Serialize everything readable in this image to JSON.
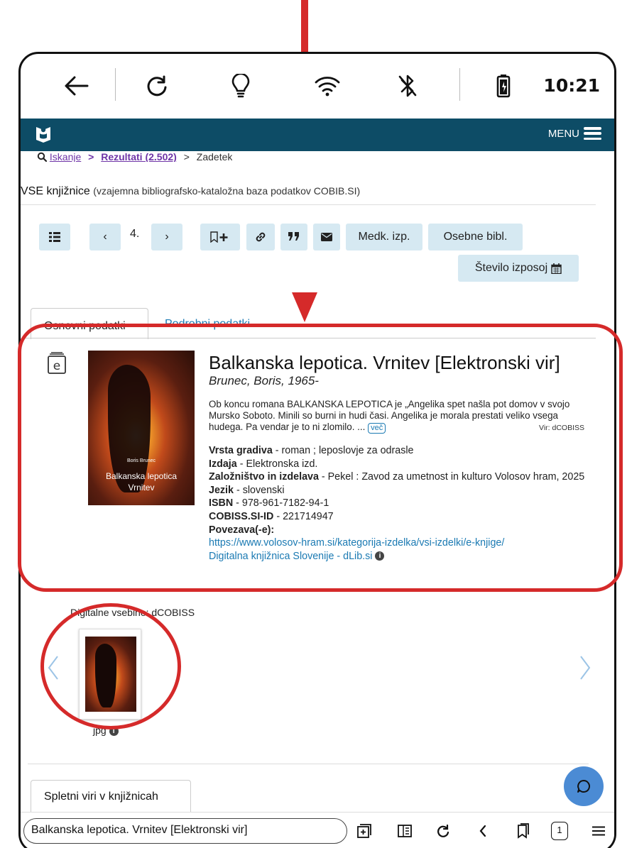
{
  "status_bar": {
    "time": "10:21",
    "icons": [
      "back-arrow-icon",
      "refresh-icon",
      "lightbulb-icon",
      "wifi-icon",
      "bluetooth-off-icon",
      "battery-icon"
    ]
  },
  "app_bar": {
    "menu_label": "MENU"
  },
  "breadcrumb": {
    "search": "Iskanje",
    "sep1": ">",
    "results": "Rezultati (2.502)",
    "sep2": ">",
    "current": "Zadetek"
  },
  "heading": {
    "title": "VSE knjižnice",
    "subtitle": "(vzajemna bibliografsko-kataložna baza podatkov COBIB.SI)"
  },
  "toolbar": {
    "page_number": "4.",
    "prev": "‹",
    "next": "›",
    "medk_izp": "Medk. izp.",
    "osebne_bibl": "Osebne bibl.",
    "stevilo_izposoj": "Število izposoj"
  },
  "tabs": {
    "basic": "Osnovni podatki",
    "detailed": "Podrobni podatki"
  },
  "record": {
    "title": "Balkanska lepotica. Vrnitev [Elektronski vir]",
    "author": "Brunec, Boris, 1965-",
    "description": "Ob koncu romana BALKANSKA LEPOTICA je „Angelika spet našla pot domov v svojo Mursko Soboto. Minili so burni in hudi časi. Angelika je morala prestati veliko vsega hudega. Pa vendar je to ni zlomilo. ...",
    "more": "več",
    "source": "Vir: dCOBISS",
    "cover": {
      "author": "Boris Brunec",
      "title_line1": "Balkanska lepotica",
      "title_line2": "Vrnitev"
    },
    "fields": {
      "vrsta_label": "Vrsta gradiva",
      "vrsta_value": "- roman ; leposlovje za odrasle",
      "izdaja_label": "Izdaja",
      "izdaja_value": "- Elektronska izd.",
      "zalozba_label": "Založništvo in izdelava",
      "zalozba_value": "- Pekel : Zavod za umetnost in kulturo Volosov hram, 2025",
      "jezik_label": "Jezik",
      "jezik_value": "- slovenski",
      "isbn_label": "ISBN",
      "isbn_value": "- 978-961-7182-94-1",
      "cobiss_label": "COBISS.SI-ID",
      "cobiss_value": "- 221714947",
      "povezave_label": "Povezava(-e):",
      "link1": "https://www.volosov-hram.si/kategorija-izdelka/vsi-izdelki/e-knjige/",
      "link2": "Digitalna knjižnica Slovenije - dLib.si"
    }
  },
  "digital": {
    "label": "Digitalne vsebine: dCOBISS",
    "file_type": "jpg"
  },
  "spletni_viri": "Spletni viri v knjižnicah",
  "bottom_bar": {
    "url_text": "Balkanska lepotica. Vrnitev [Elektronski vir]",
    "page_count": "1"
  },
  "colors": {
    "app_bar": "#0d4c66",
    "button_bg": "#d6e9f2",
    "link": "#1b7ab3",
    "annotation": "#d52a2a",
    "chat_button": "#4b8bd4"
  }
}
